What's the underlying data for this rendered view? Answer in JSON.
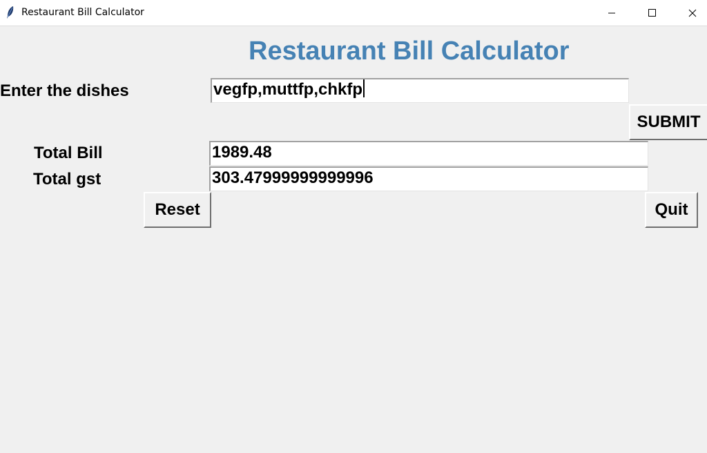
{
  "window": {
    "title": "Restaurant Bill Calculator",
    "controls": [
      "minimize-icon",
      "maximize-icon",
      "close-icon"
    ]
  },
  "heading": "Restaurant Bill Calculator",
  "dishes": {
    "label": "Enter the dishes",
    "value": "vegfp,muttfp,chkfp"
  },
  "submit_label": "SUBMIT",
  "total_bill": {
    "label": "Total Bill",
    "value": "1989.48"
  },
  "total_gst": {
    "label": "Total gst",
    "value": "303.47999999999996"
  },
  "reset_label": "Reset",
  "quit_label": "Quit",
  "colors": {
    "heading": "#4682b4",
    "background": "#f0f0f0"
  }
}
